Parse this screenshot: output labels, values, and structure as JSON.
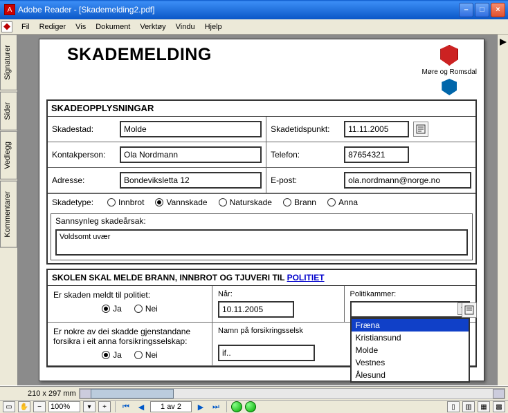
{
  "window": {
    "title": "Adobe Reader - [Skademelding2.pdf]"
  },
  "menu": {
    "fil": "Fil",
    "rediger": "Rediger",
    "vis": "Vis",
    "dokument": "Dokument",
    "verktoy": "Verktøy",
    "vindu": "Vindu",
    "hjelp": "Hjelp"
  },
  "sidetabs": {
    "signaturer": "Signaturer",
    "sider": "Sider",
    "vedlegg": "Vedlegg",
    "kommentarer": "Kommentarer"
  },
  "header": {
    "title": "SKADEMELDING",
    "county": "Møre og Romsdal"
  },
  "section1": {
    "title": "SKADEOPPLYSNINGAR",
    "skadestad_lbl": "Skadestad:",
    "skadestad": "Molde",
    "tidspunkt_lbl": "Skadetidspunkt:",
    "tidspunkt": "11.11.2005",
    "kontakt_lbl": "Kontakperson:",
    "kontakt": "Ola Nordmann",
    "telefon_lbl": "Telefon:",
    "telefon": "87654321",
    "adresse_lbl": "Adresse:",
    "adresse": "Bondeviksletta 12",
    "epost_lbl": "E-post:",
    "epost": "ola.nordmann@norge.no",
    "skadetype_lbl": "Skadetype:",
    "radios": {
      "innbrot": "Innbrot",
      "vannskade": "Vannskade",
      "naturskade": "Naturskade",
      "brann": "Brann",
      "anna": "Anna"
    },
    "selected": "vannskade",
    "aarsak_lbl": "Sannsynleg skadeårsak:",
    "aarsak": "Voldsomt uvær"
  },
  "section2": {
    "title_pre": "SKOLEN SKAL MELDE BRANN, INNBROT OG TJUVERI TIL ",
    "title_link": "POLITIET",
    "politi_q": "Er skaden meldt til politiet:",
    "nar_lbl": "Når:",
    "nar": "10.11.2005",
    "kammer_lbl": "Politikammer:",
    "ja": "Ja",
    "nei": "Nei",
    "forsikra_q": "Er nokre av dei skadde gjenstandane forsikra i eit anna forsikringsselskap:",
    "selskap_lbl": "Namn på forsikringsselsk",
    "selskap": "if..",
    "dropdown": {
      "selected": "Fræna",
      "options": [
        "Fræna",
        "Kristiansund",
        "Molde",
        "Vestnes",
        "Ålesund"
      ]
    }
  },
  "status": {
    "pagesize": "210 x 297 mm"
  },
  "toolbar": {
    "zoom": "100%",
    "page": "1 av 2"
  }
}
